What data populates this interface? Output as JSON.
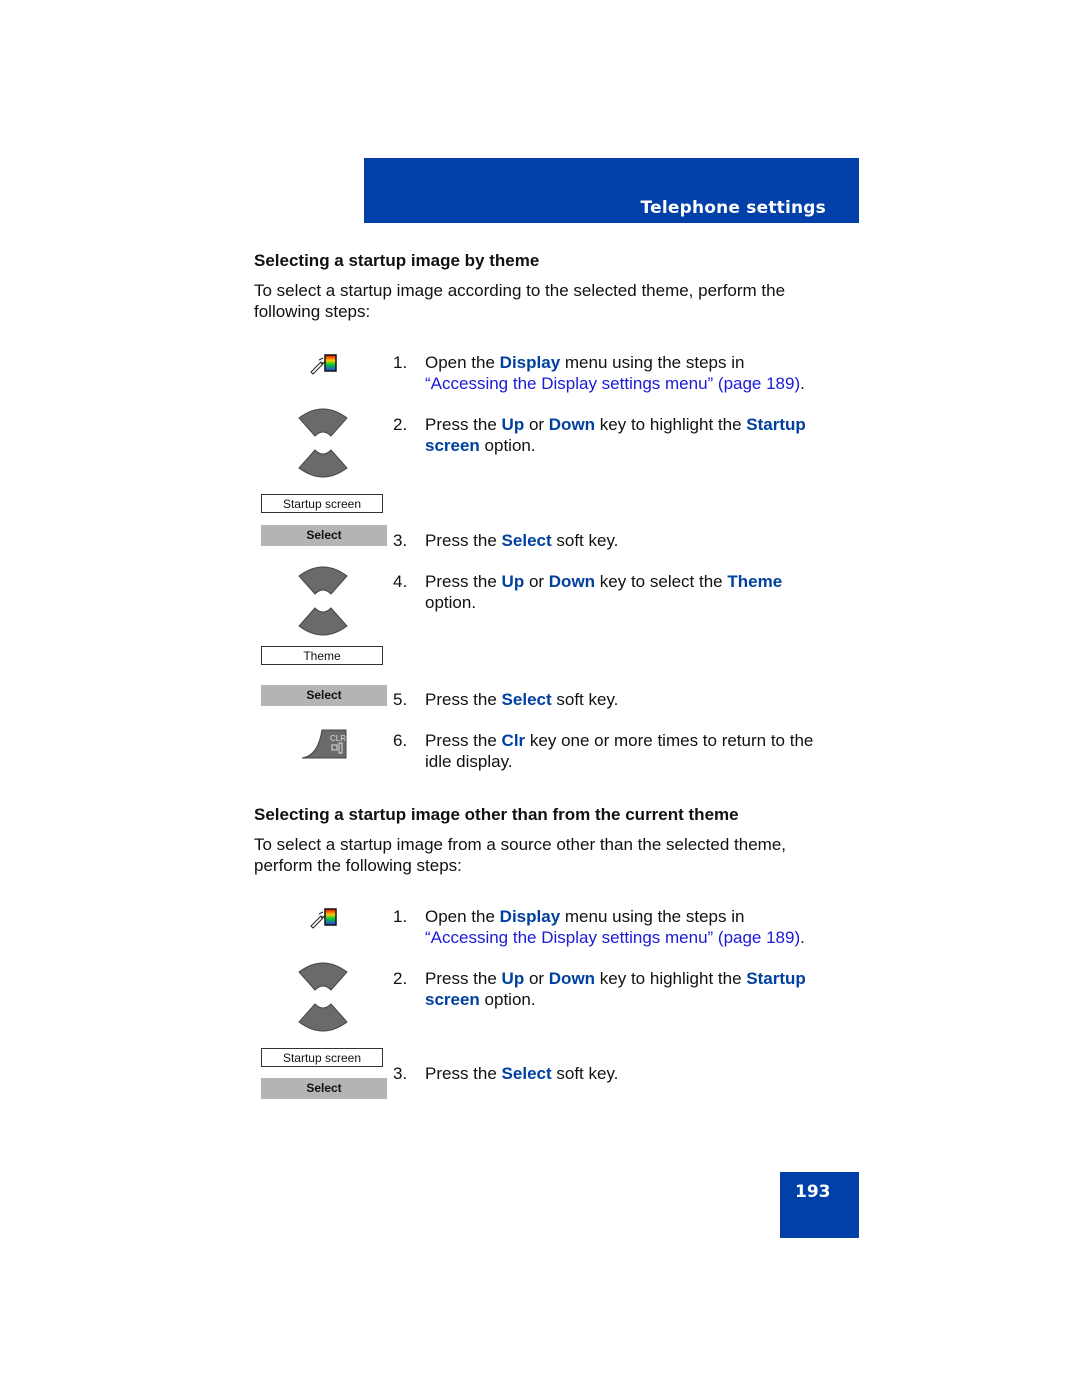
{
  "header": {
    "section_title": "Telephone settings"
  },
  "sections": [
    {
      "heading": "Selecting a startup image by theme",
      "intro": "To select a startup image according to the selected theme, perform the following steps:",
      "steps": [
        {
          "num": "1.",
          "parts": [
            "Open the ",
            "Display",
            " menu using the steps in "
          ],
          "link": "“Accessing the Display settings menu” (page 189)",
          "end": "."
        },
        {
          "num": "2.",
          "parts": [
            "Press the ",
            "Up",
            " or ",
            "Down",
            " key to highlight the ",
            "Startup screen",
            " option."
          ]
        },
        {
          "num": "3.",
          "parts": [
            "Press the ",
            "Select",
            " soft key."
          ]
        },
        {
          "num": "4.",
          "parts": [
            "Press the ",
            "Up",
            " or ",
            "Down",
            " key to select the ",
            "Theme",
            " option."
          ]
        },
        {
          "num": "5.",
          "parts": [
            "Press the ",
            "Select",
            " soft key."
          ]
        },
        {
          "num": "6.",
          "parts": [
            "Press the ",
            "Clr",
            " key one or more times to return to the idle display."
          ]
        }
      ],
      "labels": {
        "startup_screen": "Startup screen",
        "select": "Select",
        "theme": "Theme",
        "select2": "Select",
        "clr": "CLR"
      }
    },
    {
      "heading": "Selecting a startup image other than from the current theme",
      "intro": "To select a startup image from a source other than the selected theme, perform the following steps:",
      "steps": [
        {
          "num": "1.",
          "parts": [
            "Open the ",
            "Display",
            " menu using the steps in "
          ],
          "link": "“Accessing the Display settings menu” (page 189)",
          "end": "."
        },
        {
          "num": "2.",
          "parts": [
            "Press the ",
            "Up",
            " or ",
            "Down",
            " key to highlight the ",
            "Startup screen",
            " option."
          ]
        },
        {
          "num": "3.",
          "parts": [
            "Press the ",
            "Select",
            " soft key."
          ]
        }
      ],
      "labels": {
        "startup_screen": "Startup screen",
        "select": "Select"
      }
    }
  ],
  "page_number": "193"
}
